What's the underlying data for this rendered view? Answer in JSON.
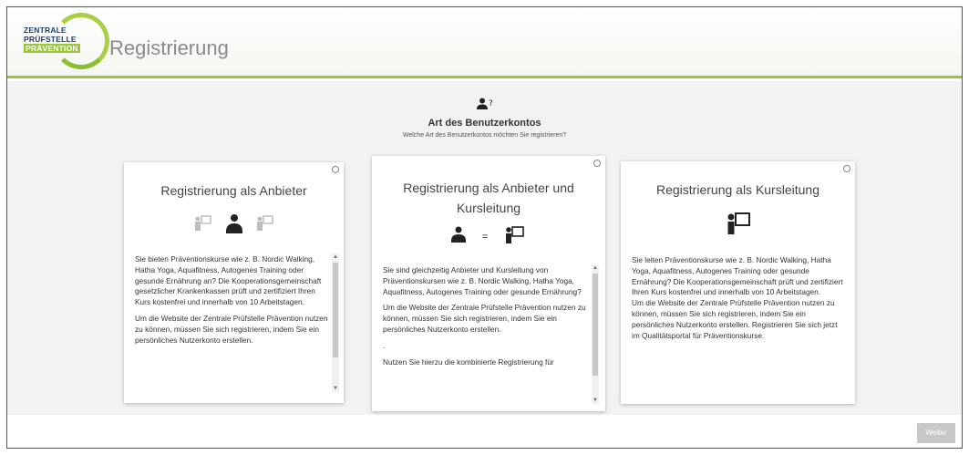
{
  "logo": {
    "line1": "ZENTRALE",
    "line2": "PRÜFSTELLE",
    "line3": "PRÄVENTION"
  },
  "header": {
    "title": "Registrierung"
  },
  "section": {
    "heading": "Art des Benutzerkontos",
    "subheading": "Welche Art des Benutzerkontos möchten Sie registrieren?"
  },
  "cards": [
    {
      "title": "Registrierung als Anbieter",
      "paragraphs": [
        "Sie bieten Präventionskurse wie z. B. Nordic Walking, Hatha Yoga, Aquafitness, Autogenes Training oder gesunde Ernährung an? Die Kooperationsgemeinschaft gesetzlicher Krankenkassen prüft und zertifiziert Ihren Kurs kostenfrei und innerhalb von 10 Arbeitstagen.",
        "Um die Website der Zentrale Prüfstelle Prävention nutzen zu können, müssen Sie sich registrieren, indem Sie ein persönliches Nutzerkonto erstellen."
      ]
    },
    {
      "title": "Registrierung als Anbieter und Kursleitung",
      "equals": "=",
      "paragraphs": [
        "Sie sind gleichzeitig Anbieter und Kursleitung von Präventionskursen wie z. B. Nordic Walking, Hatha Yoga, Aquafitness, Autogenes Training oder gesunde Ernährung?",
        "Um die Website der Zentrale Prüfstelle Prävention nutzen zu können, müssen Sie sich registrieren, indem Sie ein persönliches Nutzerkonto erstellen.",
        ".",
        "Nutzen Sie hierzu die kombinierte Registrierung für"
      ]
    },
    {
      "title": "Registrierung als Kursleitung",
      "paragraphs": [
        "Sie leiten Präventionskurse wie z. B. Nordic Walking, Hatha Yoga, Aquafitness, Autogenes Training oder gesunde Ernährung? Die Kooperationsgemeinschaft prüft und zertifiziert Ihren Kurs kostenfrei und innerhalb von 10 Arbeitstagen.",
        "Um die Website der Zentrale Prüfstelle Prävention nutzen zu können, müssen Sie sich registrieren, indem Sie ein persönliches Nutzerkonto erstellen. Registrieren Sie sich jetzt im Qualitätsportal für Präventionskurse."
      ]
    }
  ],
  "buttons": {
    "next": "Weiter"
  },
  "icons": {
    "heading": "user-question-icon",
    "provider": "provider-person-icon",
    "trainer": "trainer-board-icon"
  },
  "colors": {
    "accent_green": "#9bc53d",
    "logo_navy": "#1f3f67",
    "content_bg": "#f2f2f2",
    "button_disabled": "#c8c8c8"
  }
}
